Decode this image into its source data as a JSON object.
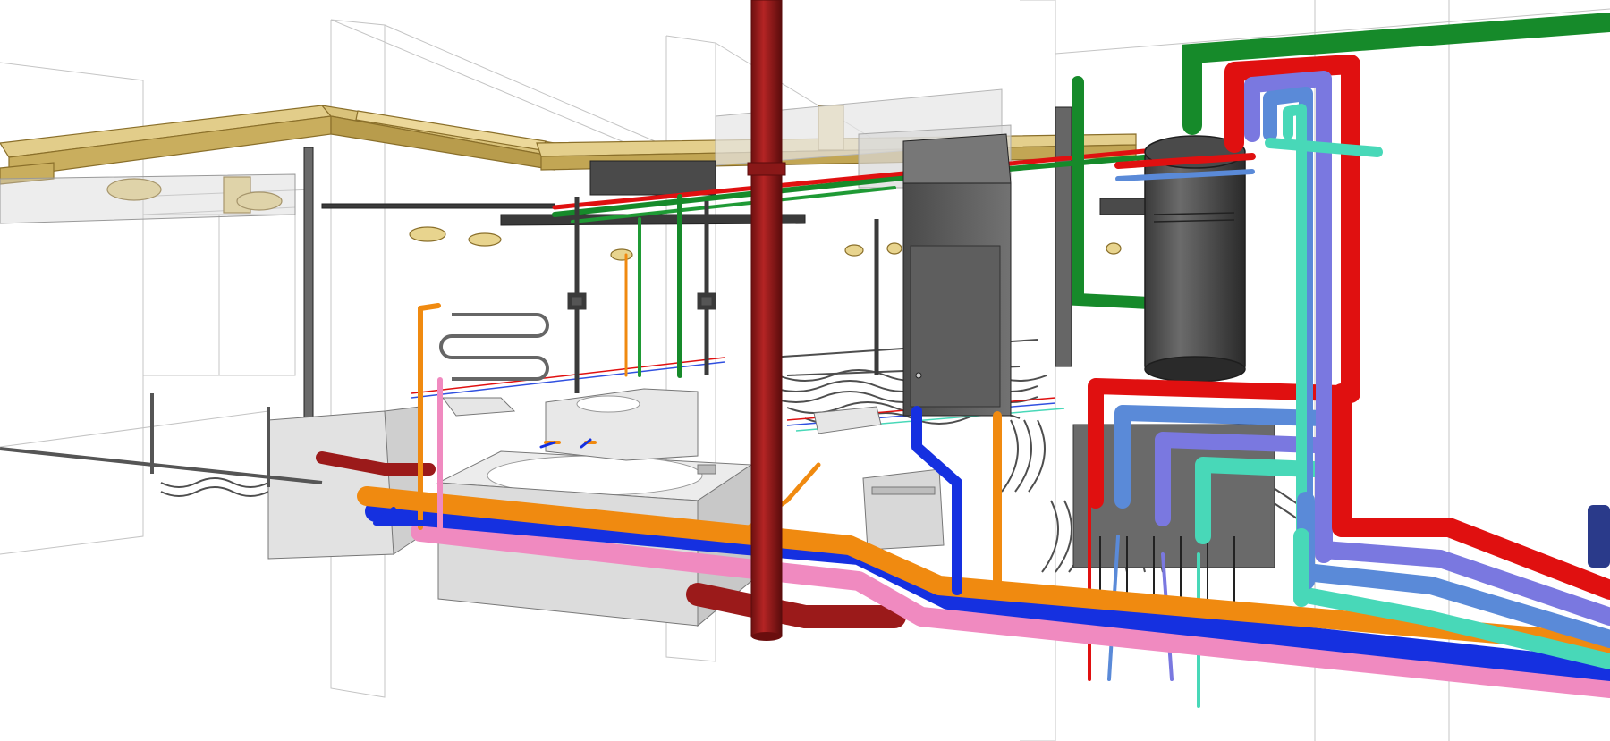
{
  "scene": {
    "kind": "3D isometric MEP/plumbing BIM model",
    "colors": {
      "background": "#ffffff",
      "wireframe": "#bdbdbd",
      "red_pipe": "#e01010",
      "dark_red_pipe": "#9b1a1a",
      "blue_pipe": "#1530e0",
      "light_blue_pipe": "#5a8ad8",
      "purple_pipe": "#7a78e0",
      "teal_pipe": "#48d8b8",
      "orange_pipe": "#f08a10",
      "pink_pipe": "#f08ac0",
      "green_pipe": "#168a2a",
      "ceiling_duct": "#d8c080",
      "boiler": "#555555",
      "cabinet": "#666666",
      "fixture": "#e2e2e2",
      "floor_heating": "#5a5a5a"
    },
    "components": [
      "wireframe-walls",
      "ceiling-duct",
      "floor-heating-loops",
      "bathtub",
      "washbasin",
      "towel-radiator",
      "riser-pipe",
      "distribution-cabinet",
      "water-heater",
      "manifold",
      "supply-return-pipes"
    ]
  }
}
